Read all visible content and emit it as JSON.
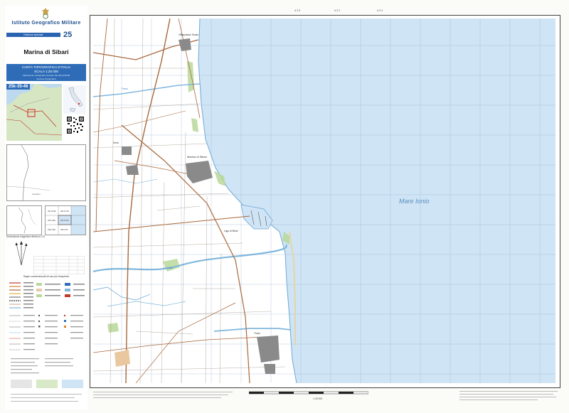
{
  "panel": {
    "institute": "Istituto Geografico Militare",
    "edition": "Edizione speciale",
    "sheet_number": "25",
    "sheet_title": "Marina di Sibari",
    "series_line1": "CARTA TOPOGRAFICA D'ITALIA",
    "series_line2": "SCALA 1:25 000",
    "series_note1": "Allestimento cartografico derivato dai dati dell'IGM",
    "series_note2": "Sezione Topografica",
    "locator_code": "25k-35-46",
    "decl_caption": "Declinazione magnetica riferita al 1.00",
    "legend_title": "Segni convenzionali di uso più frequente"
  },
  "colors": {
    "sea": "#cfe4f5",
    "land": "#fbfbf8",
    "road": "#a8683c",
    "water": "#7fb7de",
    "green": "#b9d89a",
    "brand_blue": "#2e6cb8"
  },
  "map": {
    "sea_label": "Mare Ionio"
  }
}
